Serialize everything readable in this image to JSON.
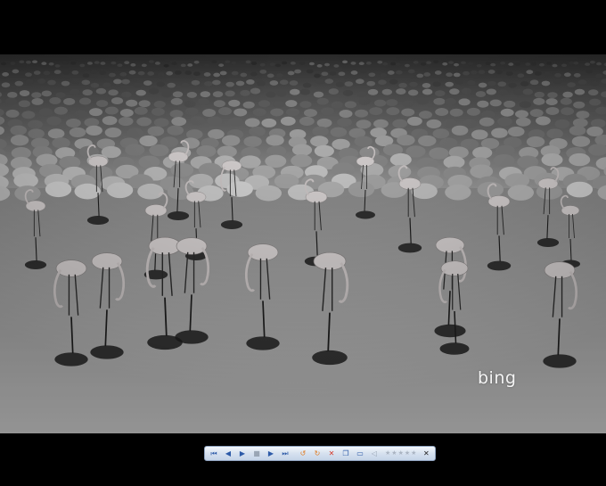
{
  "photo": {
    "subject": "flamingos",
    "watermark_text": "bing"
  },
  "toolbar": {
    "buttons": [
      {
        "name": "first-image-button",
        "icon": "skip-back-icon",
        "glyph": "⏮"
      },
      {
        "name": "previous-image-button",
        "icon": "previous-icon",
        "glyph": "◀"
      },
      {
        "name": "play-slideshow-button",
        "icon": "play-icon",
        "glyph": "▶"
      },
      {
        "name": "stop-button",
        "icon": "stop-icon",
        "glyph": "■"
      },
      {
        "name": "next-image-button",
        "icon": "next-icon",
        "glyph": "▶"
      },
      {
        "name": "last-image-button",
        "icon": "skip-forward-icon",
        "glyph": "⏭"
      },
      {
        "name": "rotate-left-button",
        "icon": "rotate-left-icon",
        "glyph": "↺"
      },
      {
        "name": "rotate-right-button",
        "icon": "rotate-right-icon",
        "glyph": "↻"
      },
      {
        "name": "delete-button",
        "icon": "delete-icon",
        "glyph": "✕"
      },
      {
        "name": "copy-button",
        "icon": "copy-icon",
        "glyph": "❐"
      },
      {
        "name": "window-mode-button",
        "icon": "window-icon",
        "glyph": "▭"
      },
      {
        "name": "sound-button",
        "icon": "speaker-icon",
        "glyph": "◁"
      }
    ],
    "rating_stars": 5,
    "close_glyph": "✕",
    "colors": {
      "accent": "#2d5ba8",
      "red": "#d63a2b",
      "orange": "#e07a1f"
    }
  }
}
